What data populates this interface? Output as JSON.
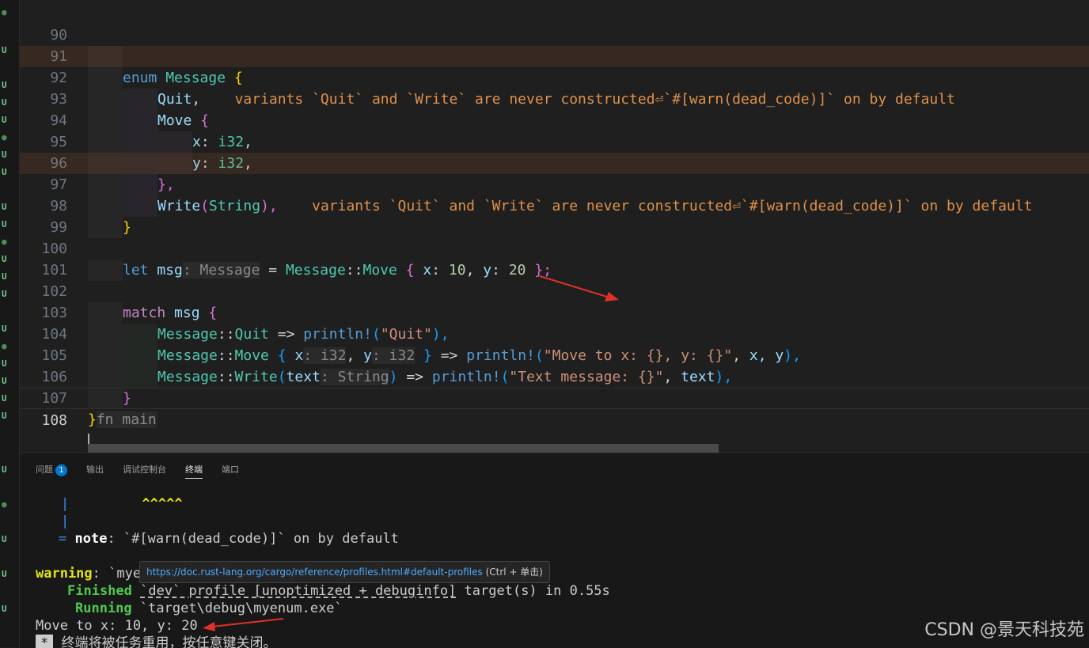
{
  "editor": {
    "lines": [
      {
        "num": "90"
      },
      {
        "num": "91",
        "code": {
          "kw": "enum",
          "name": "Message",
          "open": "{"
        }
      },
      {
        "num": "92",
        "code": {
          "variant": "Quit",
          "comma": ",",
          "diagnostic": "variants `Quit` and `Write` are never constructed⏎`#[warn(dead_code)]` on by default"
        }
      },
      {
        "num": "93",
        "code": {
          "variant": "Move",
          "open": "{"
        }
      },
      {
        "num": "94",
        "code": {
          "field": "x",
          "type": "i32"
        }
      },
      {
        "num": "95",
        "code": {
          "field": "y",
          "type": "i32"
        }
      },
      {
        "num": "96",
        "code": {
          "close": "},"
        }
      },
      {
        "num": "97",
        "code": {
          "variant": "Write",
          "paren_open": "(",
          "type": "String",
          "paren_close": "),",
          "diagnostic": "variants `Quit` and `Write` are never constructed⏎`#[warn(dead_code)]` on by default"
        }
      },
      {
        "num": "98",
        "code": {
          "close": "}"
        }
      },
      {
        "num": "99"
      },
      {
        "num": "100",
        "code": {
          "kw": "let",
          "var": "msg",
          "hint": ": Message",
          "eq": "=",
          "type": "Message",
          "sep": "::",
          "variant": "Move",
          "open": "{",
          "x": "x",
          "xval": "10",
          "y": "y",
          "yval": "20",
          "close": "};"
        }
      },
      {
        "num": "101"
      },
      {
        "num": "102",
        "code": {
          "kw": "match",
          "var": "msg",
          "open": "{"
        }
      },
      {
        "num": "103",
        "code": {
          "type": "Message",
          "sep": "::",
          "variant": "Quit",
          "arrow": "=>",
          "macro": "println!",
          "str": "\"Quit\"",
          "end": "),"
        }
      },
      {
        "num": "104",
        "code": {
          "type": "Message",
          "sep": "::",
          "variant": "Move",
          "x": "x",
          "xhint": ": i32",
          "y": "y",
          "yhint": ": i32",
          "arrow": "=>",
          "macro": "println!",
          "str": "\"Move to x: {}, y: {}\"",
          "args": "x, y",
          "end": "),"
        }
      },
      {
        "num": "105",
        "code": {
          "type": "Message",
          "sep": "::",
          "variant": "Write",
          "var": "text",
          "hint": ": String",
          "arrow": "=>",
          "macro": "println!",
          "str": "\"Text message: {}\"",
          "args": "text",
          "end": "),"
        }
      },
      {
        "num": "106",
        "code": {
          "close": "}"
        }
      },
      {
        "num": "107",
        "code": {
          "close": "}",
          "hint": "fn main"
        }
      },
      {
        "num": "108"
      }
    ]
  },
  "panel": {
    "tabs": [
      {
        "label": "问题",
        "badge": "1"
      },
      {
        "label": "输出"
      },
      {
        "label": "调试控制台"
      },
      {
        "label": "终端",
        "active": true
      },
      {
        "label": "端口"
      }
    ],
    "terminal": {
      "carets": "^^^^^",
      "pipe": "|",
      "note_eq": "=",
      "note_label": "note",
      "note_text": ": `#[warn(dead_code)]` on by default",
      "warning_label": "warning",
      "warning_text": ": `mye",
      "finished_label": "Finished",
      "finished_text1": "`dev` profile [unoptimized + debuginfo]",
      "finished_text2": " target(s) in 0.55s",
      "running_label": "Running",
      "running_text": "`target\\debug\\myenum.exe`",
      "output": "Move to x: 10, y: 20",
      "reuse_marker": "*",
      "reuse_text": "终端将被任务重用，按任意键关闭。"
    },
    "tooltip": {
      "url": "https://doc.rust-lang.org/cargo/reference/profiles.html#default-profiles",
      "hint": "(Ctrl + 单击)"
    }
  },
  "gutter_marks": [
    "dot",
    "U",
    "U",
    "U",
    "U",
    "dot",
    "U",
    "U",
    "U",
    "U",
    "dot",
    "U",
    "U",
    "U",
    "U",
    "dot",
    "U",
    "U",
    "U",
    "U",
    "U",
    "dot",
    "U",
    "U",
    "U"
  ],
  "watermark": "CSDN @景天科技苑",
  "colors": {
    "annotation_arrow": "#e0302a",
    "diagnostic": "#e0914a",
    "link": "#4daafc"
  }
}
